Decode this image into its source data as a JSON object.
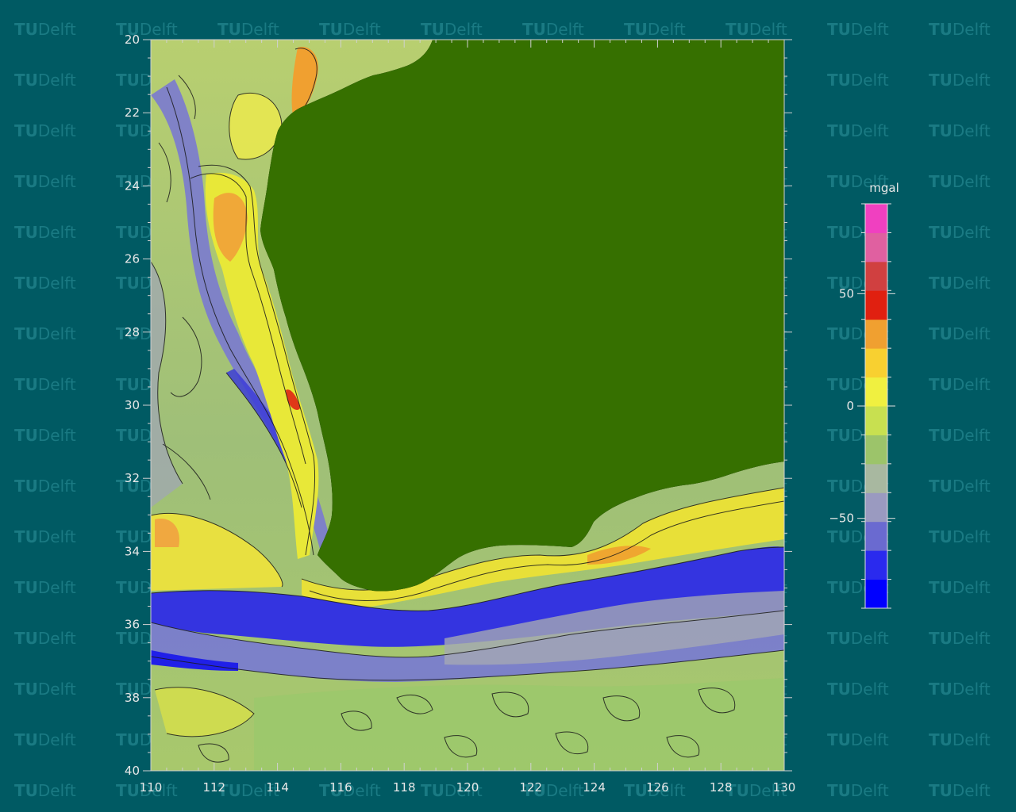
{
  "watermark": {
    "brand_bold": "TU",
    "brand_light": "Delft"
  },
  "map": {
    "x_axis": {
      "min": 110,
      "max": 130,
      "ticks": [
        "110",
        "112",
        "114",
        "116",
        "118",
        "120",
        "122",
        "124",
        "126",
        "128",
        "130"
      ]
    },
    "y_axis": {
      "min": 20,
      "max": 40,
      "inverted": true,
      "ticks": [
        "20",
        "22",
        "24",
        "26",
        "28",
        "30",
        "32",
        "34",
        "36",
        "38",
        "40"
      ]
    },
    "land_color": "#367000",
    "ocean_base_color": "#9cc46a",
    "contours": true
  },
  "colorbar": {
    "unit": "mgal",
    "tick_labels": [
      "50",
      "0",
      "−50"
    ],
    "tick_values": [
      50,
      0,
      -50
    ],
    "range": [
      -90,
      90
    ],
    "colors": [
      "#0000ff",
      "#2a2aee",
      "#6a6ad0",
      "#9a9ac0",
      "#a8b8a0",
      "#9cc46a",
      "#c8e050",
      "#f0f040",
      "#f8d030",
      "#f0a030",
      "#e02010",
      "#d04040",
      "#e060a0",
      "#f040c0"
    ]
  }
}
